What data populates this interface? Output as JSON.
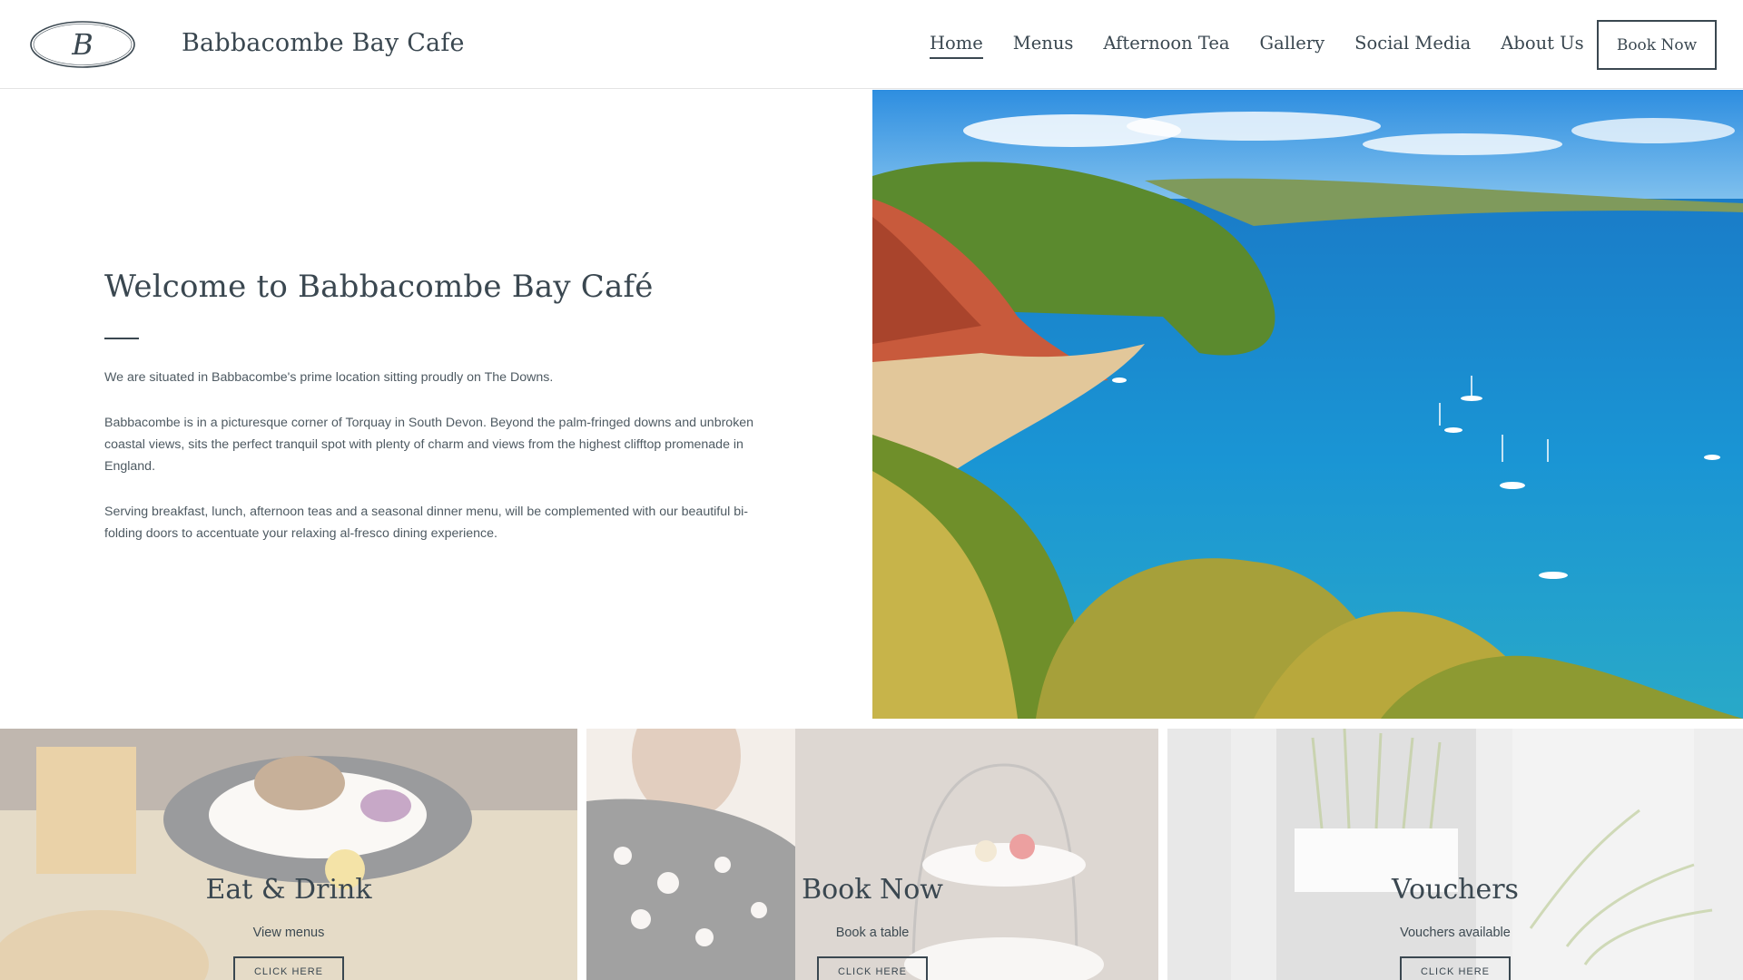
{
  "header": {
    "logo_letter": "B",
    "site_title": "Babbacombe Bay Cafe",
    "nav": [
      {
        "label": "Home",
        "active": true
      },
      {
        "label": "Menus"
      },
      {
        "label": "Afternoon Tea"
      },
      {
        "label": "Gallery"
      },
      {
        "label": "Social Media"
      },
      {
        "label": "About Us"
      }
    ],
    "book_button": "Book Now"
  },
  "welcome": {
    "title": "Welcome to Babbacombe Bay Café",
    "paragraphs": [
      "We are situated in Babbacombe's prime location sitting proudly on The Downs.",
      "Babbacombe is in a picturesque corner of Torquay in South Devon. Beyond the  palm-fringed downs and unbroken coastal views, sits the perfect tranquil spot with plenty of charm and views from the highest clifftop promenade in England.",
      "Serving breakfast, lunch, afternoon teas and a  seasonal dinner menu, will be complemented with our beautiful bi-folding doors to accentuate your relaxing al-fresco dining experience."
    ]
  },
  "cards": [
    {
      "title": "Eat & Drink",
      "subtitle": "View menus",
      "button": "CLICK HERE"
    },
    {
      "title": "Book Now",
      "subtitle": "Book a table",
      "button": "CLICK HERE"
    },
    {
      "title": "Vouchers",
      "subtitle": "Vouchers available",
      "button": "CLICK HERE"
    }
  ],
  "colors": {
    "text": "#3a4750",
    "sea": "#1f8fd0",
    "sky": "#3a9ae0",
    "cliff": "#c85a3c"
  }
}
